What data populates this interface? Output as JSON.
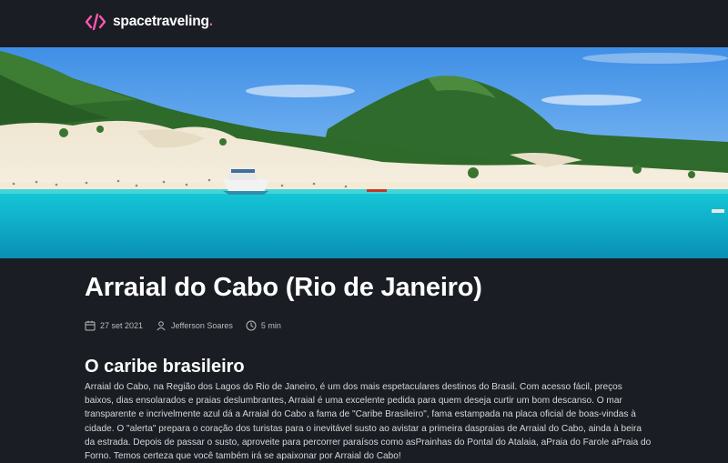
{
  "header": {
    "brand_name": "spacetraveling",
    "brand_dot": ".",
    "brand_icon": "code-brackets-icon",
    "accent_color": "#ff57b2"
  },
  "post": {
    "title": "Arraial do Cabo (Rio de Janeiro)",
    "meta": {
      "date": "27 set 2021",
      "author": "Jefferson Soares",
      "reading_time": "5 min"
    },
    "section_heading": "O caribe brasileiro",
    "body": "Arraial do Cabo, na Região dos Lagos do Rio de Janeiro, é um dos mais espetaculares destinos do Brasil. Com acesso fácil, preços baixos, dias ensolarados e praias deslumbrantes, Arraial é uma excelente pedida para quem deseja curtir um bom descanso. O mar transparente e incrivelmente azul dá a Arraial do Cabo a fama de \"Caribe Brasileiro\", fama estampada na placa oficial de boas-vindas à cidade. O \"alerta\" prepara o coração dos turistas para o inevitável susto ao avistar a primeira daspraias de Arraial do Cabo, ainda à beira da estrada. Depois de passar o susto, aproveite para percorrer paraísos como asPrainhas do Pontal do Atalaia, aPraia do Farole aPraia do Forno. Temos certeza que você também irá se apaixonar por Arraial do Cabo!"
  },
  "colors": {
    "background": "#1a1d23",
    "text": "#f8f8f8",
    "body_text": "#d7d7d7",
    "meta_text": "#bbbbbb"
  }
}
